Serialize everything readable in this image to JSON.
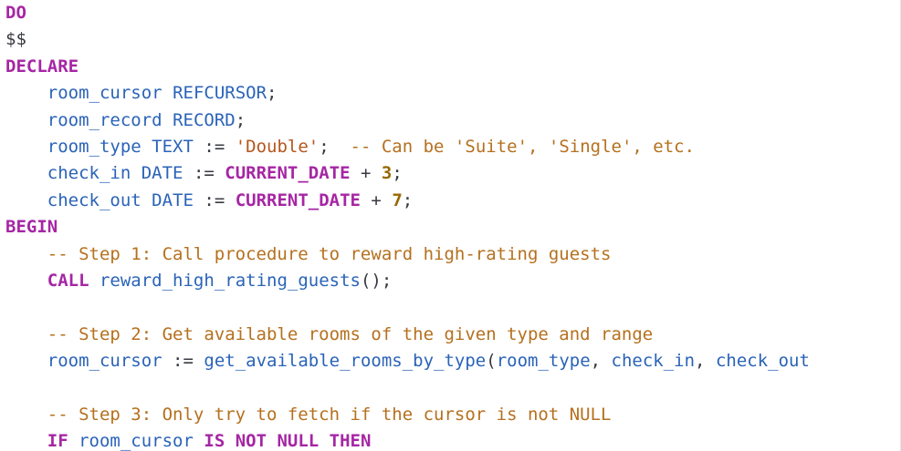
{
  "editor": {
    "language": "plpgsql",
    "colors": {
      "keyword": "#a626a4",
      "identifier": "#2a63b8",
      "string": "#b5561c",
      "comment": "#b5701e",
      "number": "#986801",
      "plain": "#383a42"
    },
    "lines": [
      [
        {
          "t": "kw",
          "v": "DO"
        }
      ],
      [
        {
          "t": "plain",
          "v": "$$"
        }
      ],
      [
        {
          "t": "kw",
          "v": "DECLARE"
        }
      ],
      [
        {
          "t": "plain",
          "v": "    "
        },
        {
          "t": "ident",
          "v": "room_cursor"
        },
        {
          "t": "plain",
          "v": " "
        },
        {
          "t": "ident",
          "v": "REFCURSOR"
        },
        {
          "t": "plain",
          "v": ";"
        }
      ],
      [
        {
          "t": "plain",
          "v": "    "
        },
        {
          "t": "ident",
          "v": "room_record"
        },
        {
          "t": "plain",
          "v": " "
        },
        {
          "t": "ident",
          "v": "RECORD"
        },
        {
          "t": "plain",
          "v": ";"
        }
      ],
      [
        {
          "t": "plain",
          "v": "    "
        },
        {
          "t": "ident",
          "v": "room_type"
        },
        {
          "t": "plain",
          "v": " "
        },
        {
          "t": "ident",
          "v": "TEXT"
        },
        {
          "t": "plain",
          "v": " := "
        },
        {
          "t": "str",
          "v": "'Double'"
        },
        {
          "t": "plain",
          "v": ";  "
        },
        {
          "t": "comment",
          "v": "-- Can be 'Suite', 'Single', etc."
        }
      ],
      [
        {
          "t": "plain",
          "v": "    "
        },
        {
          "t": "ident",
          "v": "check_in"
        },
        {
          "t": "plain",
          "v": " "
        },
        {
          "t": "ident",
          "v": "DATE"
        },
        {
          "t": "plain",
          "v": " := "
        },
        {
          "t": "kw",
          "v": "CURRENT_DATE"
        },
        {
          "t": "plain",
          "v": " + "
        },
        {
          "t": "num",
          "v": "3"
        },
        {
          "t": "plain",
          "v": ";"
        }
      ],
      [
        {
          "t": "plain",
          "v": "    "
        },
        {
          "t": "ident",
          "v": "check_out"
        },
        {
          "t": "plain",
          "v": " "
        },
        {
          "t": "ident",
          "v": "DATE"
        },
        {
          "t": "plain",
          "v": " := "
        },
        {
          "t": "kw",
          "v": "CURRENT_DATE"
        },
        {
          "t": "plain",
          "v": " + "
        },
        {
          "t": "num",
          "v": "7"
        },
        {
          "t": "plain",
          "v": ";"
        }
      ],
      [
        {
          "t": "kw",
          "v": "BEGIN"
        }
      ],
      [
        {
          "t": "plain",
          "v": "    "
        },
        {
          "t": "comment",
          "v": "-- Step 1: Call procedure to reward high-rating guests"
        }
      ],
      [
        {
          "t": "plain",
          "v": "    "
        },
        {
          "t": "kw",
          "v": "CALL"
        },
        {
          "t": "plain",
          "v": " "
        },
        {
          "t": "ident",
          "v": "reward_high_rating_guests"
        },
        {
          "t": "plain",
          "v": "();"
        }
      ],
      [],
      [
        {
          "t": "plain",
          "v": "    "
        },
        {
          "t": "comment",
          "v": "-- Step 2: Get available rooms of the given type and range"
        }
      ],
      [
        {
          "t": "plain",
          "v": "    "
        },
        {
          "t": "ident",
          "v": "room_cursor"
        },
        {
          "t": "plain",
          "v": " := "
        },
        {
          "t": "ident",
          "v": "get_available_rooms_by_type"
        },
        {
          "t": "plain",
          "v": "("
        },
        {
          "t": "ident",
          "v": "room_type"
        },
        {
          "t": "plain",
          "v": ", "
        },
        {
          "t": "ident",
          "v": "check_in"
        },
        {
          "t": "plain",
          "v": ", "
        },
        {
          "t": "ident",
          "v": "check_out"
        }
      ],
      [],
      [
        {
          "t": "plain",
          "v": "    "
        },
        {
          "t": "comment",
          "v": "-- Step 3: Only try to fetch if the cursor is not NULL"
        }
      ],
      [
        {
          "t": "plain",
          "v": "    "
        },
        {
          "t": "kw",
          "v": "IF"
        },
        {
          "t": "plain",
          "v": " "
        },
        {
          "t": "ident",
          "v": "room_cursor"
        },
        {
          "t": "plain",
          "v": " "
        },
        {
          "t": "kw",
          "v": "IS NOT NULL THEN"
        }
      ]
    ]
  }
}
